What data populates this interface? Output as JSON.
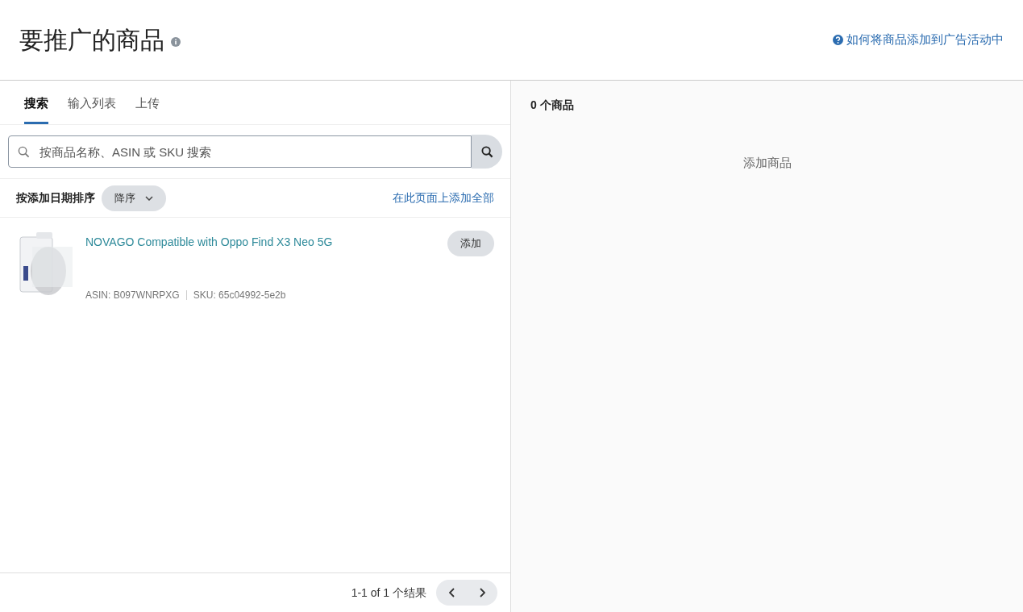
{
  "header": {
    "title": "要推广的商品",
    "help_link": "如何将商品添加到广告活动中"
  },
  "tabs": [
    {
      "label": "搜索",
      "selected": true
    },
    {
      "label": "输入列表",
      "selected": false
    },
    {
      "label": "上传",
      "selected": false
    }
  ],
  "search": {
    "placeholder": "按商品名称、ASIN 或 SKU 搜索"
  },
  "sort": {
    "label": "按添加日期排序",
    "order": "降序",
    "add_all_link": "在此页面上添加全部"
  },
  "products": [
    {
      "title": "NOVAGO Compatible with Oppo Find X3 Neo 5G",
      "asin": "ASIN: B097WNRPXG",
      "sku": "SKU: 65c04992-5e2b",
      "button": "添加"
    }
  ],
  "pagination": {
    "summary": "1-1 of 1 个结果"
  },
  "selected_panel": {
    "count": "0 个商品",
    "empty_text": "添加商品"
  }
}
